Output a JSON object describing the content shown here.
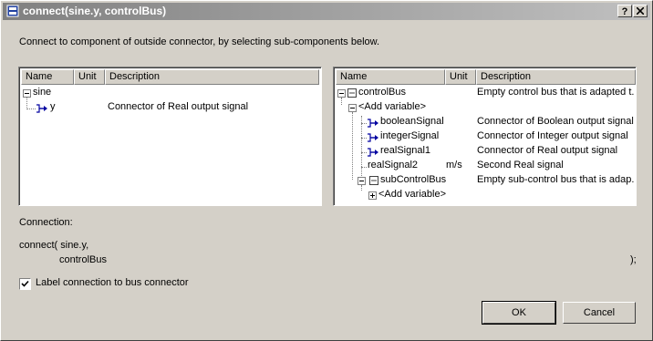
{
  "window": {
    "title": "connect(sine.y, controlBus)",
    "help_btn": "?",
    "close_btn": "X"
  },
  "instruction": "Connect to component of outside connector, by selecting sub-components below.",
  "left_tree": {
    "columns": [
      "Name",
      "Unit",
      "Description"
    ],
    "rows": [
      {
        "name": "sine",
        "unit": "",
        "desc": ""
      },
      {
        "name": "y",
        "unit": "",
        "desc": "Connector of Real output signal"
      }
    ]
  },
  "right_tree": {
    "columns": [
      "Name",
      "Unit",
      "Description"
    ],
    "rows": [
      {
        "name": "controlBus",
        "unit": "",
        "desc": "Empty control bus that is adapted t..."
      },
      {
        "name": "<Add variable>",
        "unit": "",
        "desc": ""
      },
      {
        "name": "booleanSignal",
        "unit": "",
        "desc": "Connector of Boolean output signal"
      },
      {
        "name": "integerSignal",
        "unit": "",
        "desc": "Connector of Integer output signal"
      },
      {
        "name": "realSignal1",
        "unit": "",
        "desc": "Connector of Real output signal"
      },
      {
        "name": "realSignal2",
        "unit": "m/s",
        "desc": "Second Real signal"
      },
      {
        "name": "subControlBus",
        "unit": "",
        "desc": "Empty sub-control bus that is adap..."
      },
      {
        "name": "<Add variable>",
        "unit": "",
        "desc": ""
      }
    ]
  },
  "connection": {
    "label": "Connection:",
    "line1": "connect( sine.y,",
    "line2": "controlBus",
    "line3": ");"
  },
  "checkbox": {
    "label": "Label connection to bus connector",
    "checked": true
  },
  "buttons": {
    "ok": "OK",
    "cancel": "Cancel"
  },
  "colors": {
    "title_gradient_start": "#808080",
    "title_gradient_end": "#c0c0c0",
    "face": "#d4d0c8",
    "connector_icon": "#0000a0"
  }
}
